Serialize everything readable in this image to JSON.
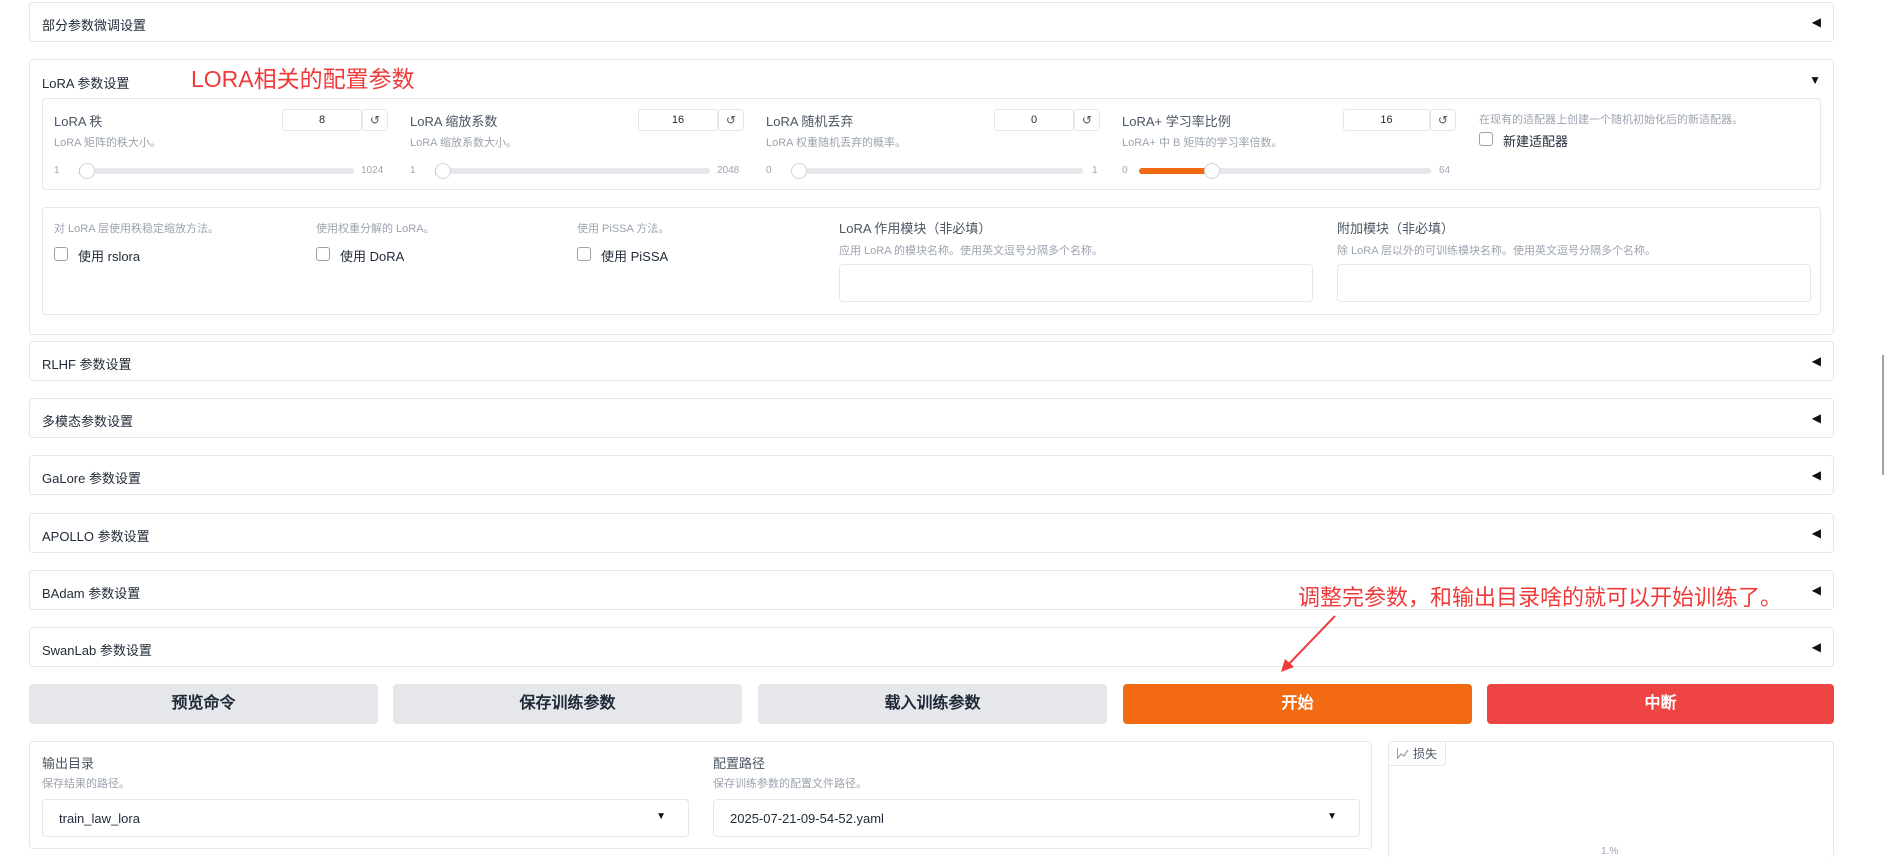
{
  "accordions": {
    "partial_tuning": {
      "title": "部分参数微调设置",
      "arrow": "◀"
    },
    "lora": {
      "title": "LoRA 参数设置",
      "arrow": "▼"
    },
    "rlhf": {
      "title": "RLHF 参数设置",
      "arrow": "◀"
    },
    "multimodal": {
      "title": "多模态参数设置",
      "arrow": "◀"
    },
    "galore": {
      "title": "GaLore 参数设置",
      "arrow": "◀"
    },
    "apollo": {
      "title": "APOLLO 参数设置",
      "arrow": "◀"
    },
    "badam": {
      "title": "BAdam 参数设置",
      "arrow": "◀"
    },
    "swanlab": {
      "title": "SwanLab 参数设置",
      "arrow": "◀"
    }
  },
  "annotations": {
    "lora_note": "LORA相关的配置参数",
    "start_note": "调整完参数，和输出目录啥的就可以开始训练了。"
  },
  "lora": {
    "reset_glyph": "↺",
    "sliders": [
      {
        "label": "LoRA 秩",
        "info": "LoRA 矩阵的秩大小。",
        "value": "8",
        "min": "1",
        "max": "1024",
        "fraction": 0.007
      },
      {
        "label": "LoRA 缩放系数",
        "info": "LoRA 缩放系数大小。",
        "value": "16",
        "min": "1",
        "max": "2048",
        "fraction": 0.007
      },
      {
        "label": "LoRA 随机丢弃",
        "info": "LoRA 权重随机丢弃的概率。",
        "value": "0",
        "min": "0",
        "max": "1",
        "fraction": 0.0
      },
      {
        "label": "LoRA+ 学习率比例",
        "info": "LoRA+ 中 B 矩阵的学习率倍数。",
        "value": "16",
        "min": "0",
        "max": "64",
        "fraction": 0.25
      }
    ],
    "create_new_adapter": {
      "info": "在现有的适配器上创建一个随机初始化后的新适配器。",
      "label": "新建适配器"
    },
    "rslora": {
      "info": "对 LoRA 层使用秩稳定缩放方法。",
      "label": "使用 rslora"
    },
    "dora": {
      "info": "使用权重分解的 LoRA。",
      "label": "使用 DoRA"
    },
    "pissa": {
      "info": "使用 PiSSA 方法。",
      "label": "使用 PiSSA"
    },
    "lora_target": {
      "label": "LoRA 作用模块（非必填）",
      "info": "应用 LoRA 的模块名称。使用英文逗号分隔多个名称。",
      "value": ""
    },
    "additional_target": {
      "label": "附加模块（非必填）",
      "info": "除 LoRA 层以外的可训练模块名称。使用英文逗号分隔多个名称。",
      "value": ""
    }
  },
  "buttons": {
    "preview": "预览命令",
    "save": "保存训练参数",
    "load": "载入训练参数",
    "start": "开始",
    "abort": "中断"
  },
  "output": {
    "output_dir": {
      "label": "输出目录",
      "info": "保存结果的路径。",
      "value": "train_law_lora"
    },
    "config_path": {
      "label": "配置路径",
      "info": "保存训练参数的配置文件路径。",
      "value": "2025-07-21-09-54-52.yaml"
    },
    "caret": "▼"
  },
  "loss_plot": {
    "icon": "chart-icon",
    "label": "损失",
    "axis_fragment": "1.%"
  },
  "colors": {
    "accent": "#f26a12",
    "danger": "#ef4444",
    "annotation": "#ef3a3a"
  }
}
